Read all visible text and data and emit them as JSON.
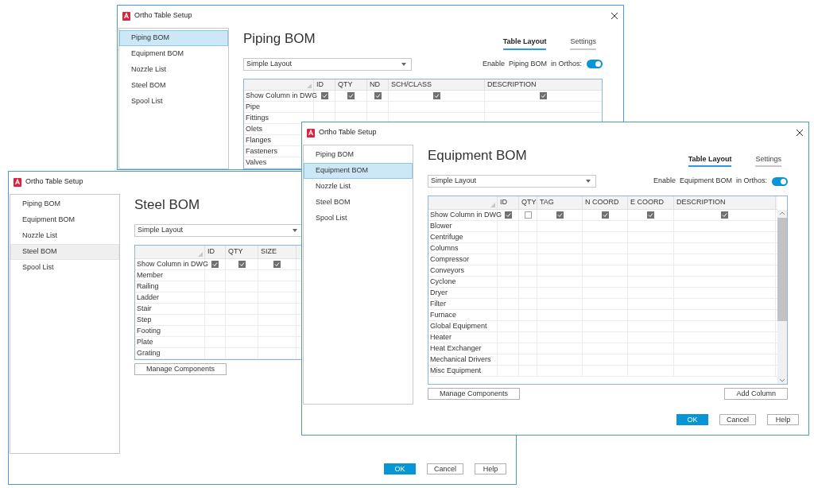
{
  "windows": [
    {
      "title": "Ortho Table Setup",
      "closable": true,
      "sidebar": [
        {
          "label": "Piping BOM",
          "selected": true
        },
        {
          "label": "Equipment BOM",
          "selected": false
        },
        {
          "label": "Nozzle List",
          "selected": false
        },
        {
          "label": "Steel BOM",
          "selected": false
        },
        {
          "label": "Spool List",
          "selected": false
        }
      ],
      "heading": "Piping BOM",
      "tabs": [
        {
          "label": "Table Layout",
          "selected": true
        },
        {
          "label": "Settings",
          "selected": false
        }
      ],
      "layout_dropdown": "Simple Layout",
      "enable": {
        "parts": [
          "Enable",
          "Piping BOM",
          "in Orthos:"
        ],
        "on": true
      },
      "table": {
        "scrollable": false,
        "show_label": "Show Column in DWG",
        "columns": [
          {
            "label": "ID",
            "checked": true
          },
          {
            "label": "QTY",
            "checked": true
          },
          {
            "label": "ND",
            "checked": true
          },
          {
            "label": "SCH/CLASS",
            "checked": true
          },
          {
            "label": "DESCRIPTION",
            "checked": true
          }
        ],
        "rows": [
          "Pipe",
          "Fittings",
          "Olets",
          "Flanges",
          "Fasteners",
          "Valves"
        ]
      }
    },
    {
      "title": "Ortho Table Setup",
      "closable": false,
      "sidebar": [
        {
          "label": "Piping BOM",
          "selected": false
        },
        {
          "label": "Equipment BOM",
          "selected": false
        },
        {
          "label": "Nozzle List",
          "selected": false
        },
        {
          "label": "Steel BOM",
          "selected": true
        },
        {
          "label": "Spool List",
          "selected": false
        }
      ],
      "heading": "Steel BOM",
      "layout_dropdown": "Simple Layout",
      "table": {
        "scrollable": false,
        "show_label": "Show Column in DWG",
        "columns": [
          {
            "label": "ID",
            "checked": true
          },
          {
            "label": "QTY",
            "checked": true
          },
          {
            "label": "SIZE",
            "checked": true
          }
        ],
        "rows": [
          "Member",
          "Railing",
          "Ladder",
          "Stair",
          "Step",
          "Footing",
          "Plate",
          "Grating"
        ]
      },
      "table_buttons": [
        {
          "label": "Manage Components"
        }
      ],
      "footer_buttons": [
        {
          "label": "OK",
          "kind": "primary"
        },
        {
          "label": "Cancel",
          "kind": "normal"
        },
        {
          "label": "Help",
          "kind": "normal"
        }
      ]
    },
    {
      "title": "Ortho Table Setup",
      "closable": true,
      "sidebar": [
        {
          "label": "Piping BOM",
          "selected": false
        },
        {
          "label": "Equipment BOM",
          "selected": true
        },
        {
          "label": "Nozzle List",
          "selected": false
        },
        {
          "label": "Steel BOM",
          "selected": false
        },
        {
          "label": "Spool List",
          "selected": false
        }
      ],
      "heading": "Equipment BOM",
      "tabs": [
        {
          "label": "Table Layout",
          "selected": true
        },
        {
          "label": "Settings",
          "selected": false
        }
      ],
      "layout_dropdown": "Simple Layout",
      "enable": {
        "parts": [
          "Enable",
          "Equipment BOM",
          "in Orthos:"
        ],
        "on": true
      },
      "table": {
        "scrollable": true,
        "show_label": "Show Column in DWG",
        "columns": [
          {
            "label": "ID",
            "checked": true
          },
          {
            "label": "QTY",
            "checked": false
          },
          {
            "label": "TAG",
            "checked": true
          },
          {
            "label": "N COORD",
            "checked": true
          },
          {
            "label": "E COORD",
            "checked": true
          },
          {
            "label": "DESCRIPTION",
            "checked": true
          }
        ],
        "rows": [
          "Blower",
          "Centrifuge",
          "Columns",
          "Compressor",
          "Conveyors",
          "Cyclone",
          "Dryer",
          "Filter",
          "Furnace",
          "Global Equipment",
          "Heater",
          "Heat Exchanger",
          "Mechanical Drivers",
          "Misc Equipment"
        ]
      },
      "table_buttons": [
        {
          "label": "Manage Components"
        },
        {
          "label": "Add Column"
        }
      ],
      "footer_buttons": [
        {
          "label": "OK",
          "kind": "primary"
        },
        {
          "label": "Cancel",
          "kind": "normal"
        },
        {
          "label": "Help",
          "kind": "normal"
        }
      ]
    }
  ]
}
